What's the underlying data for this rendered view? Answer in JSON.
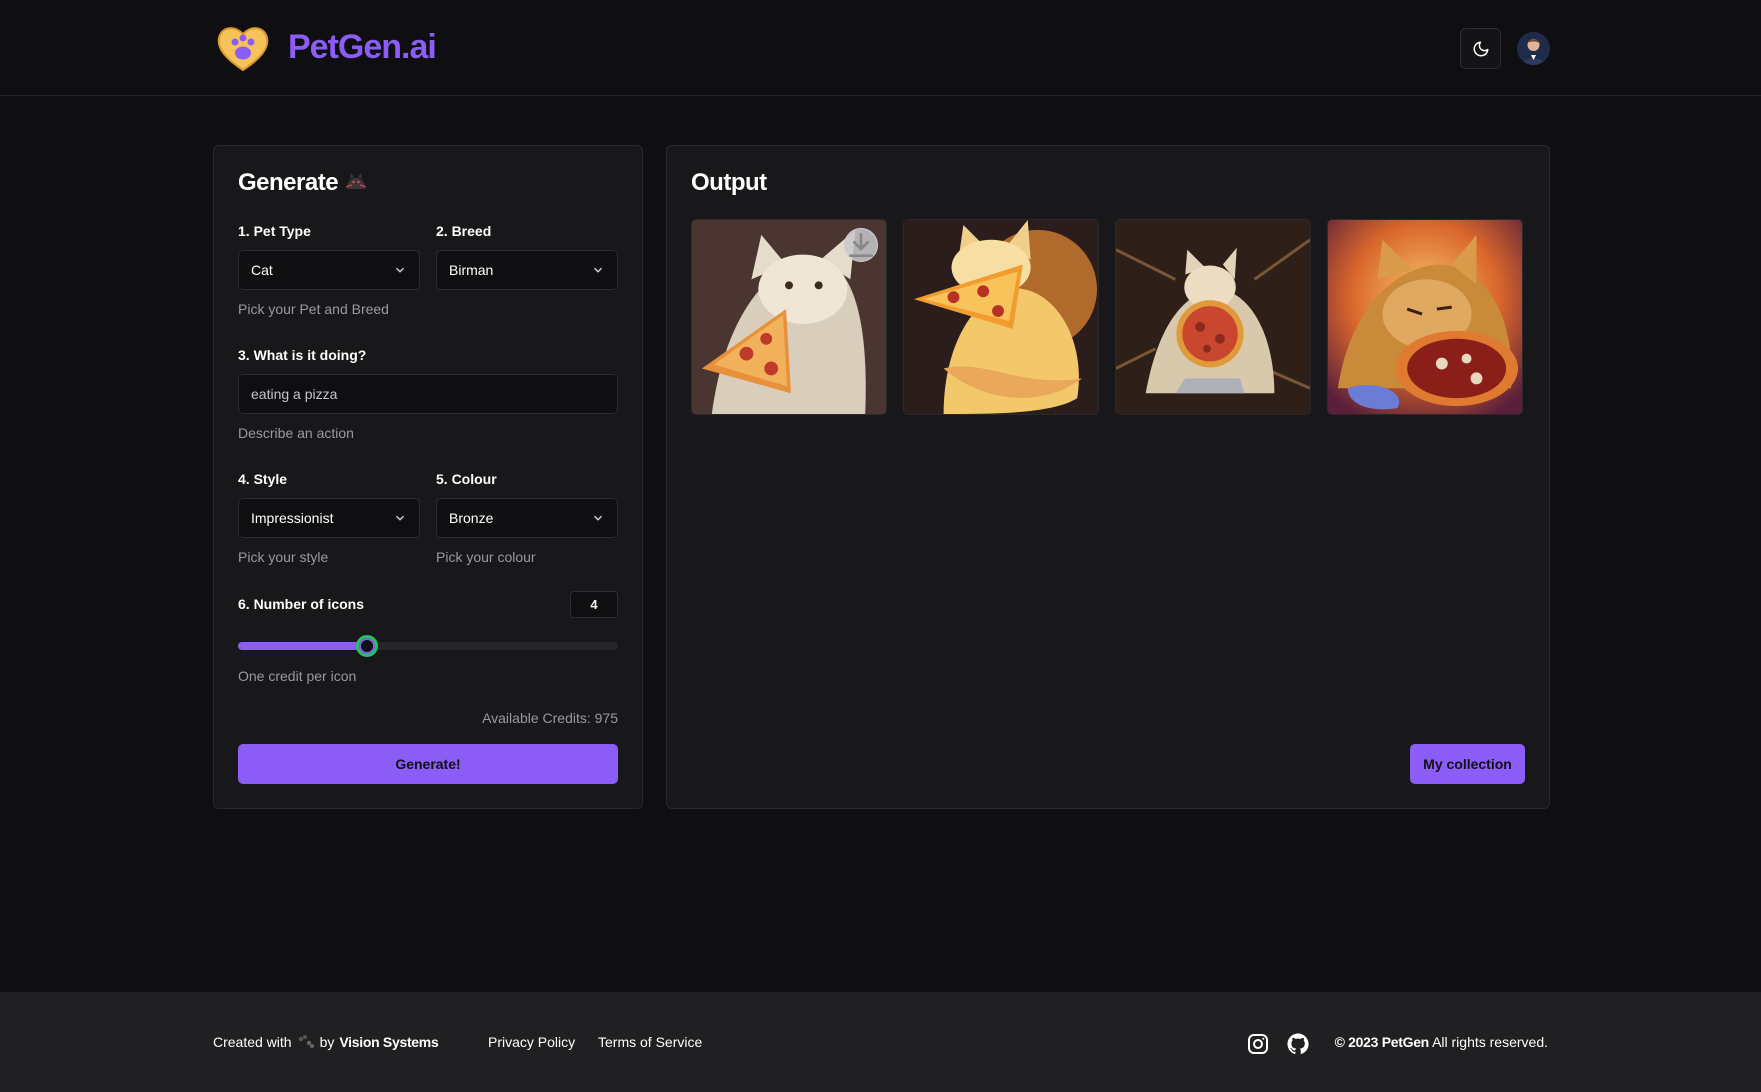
{
  "header": {
    "brand": "PetGen.ai",
    "logo_icon": "heart-paw-icon",
    "theme_icon": "moon-icon",
    "avatar_icon": "user-avatar"
  },
  "generate": {
    "title": "Generate",
    "pet_type_label": "1. Pet Type",
    "pet_type_value": "Cat",
    "breed_label": "2. Breed",
    "breed_value": "Birman",
    "pet_breed_hint": "Pick your Pet and Breed",
    "action_label": "3. What is it doing?",
    "action_placeholder": "eating a pizza",
    "action_hint": "Describe an action",
    "style_label": "4. Style",
    "style_value": "Impressionist",
    "style_hint": "Pick your style",
    "colour_label": "5. Colour",
    "colour_value": "Bronze",
    "colour_hint": "Pick your colour",
    "count_label": "6. Number of icons",
    "count_value": "4",
    "slider_fraction": 0.34,
    "count_hint": "One credit per icon",
    "credits": "Available Credits: 975",
    "button": "Generate!"
  },
  "output": {
    "title": "Output",
    "images": [
      {
        "name": "output-image-1",
        "alt": "cat eating pizza 1",
        "has_download": true
      },
      {
        "name": "output-image-2",
        "alt": "cat eating pizza 2",
        "has_download": false
      },
      {
        "name": "output-image-3",
        "alt": "cat eating pizza 3",
        "has_download": false
      },
      {
        "name": "output-image-4",
        "alt": "cat eating pizza 4",
        "has_download": false
      }
    ],
    "collection_button": "My collection"
  },
  "footer": {
    "created_prefix": "Created with",
    "created_by": "by",
    "company": "Vision Systems",
    "privacy": "Privacy Policy",
    "terms": "Terms of Service",
    "copyright_brand": "© 2023 PetGen",
    "copyright_rest": "All rights reserved."
  },
  "colors": {
    "accent": "#8b5cf6",
    "background": "#0f0e10",
    "card": "#18171a",
    "footer": "#202022"
  }
}
